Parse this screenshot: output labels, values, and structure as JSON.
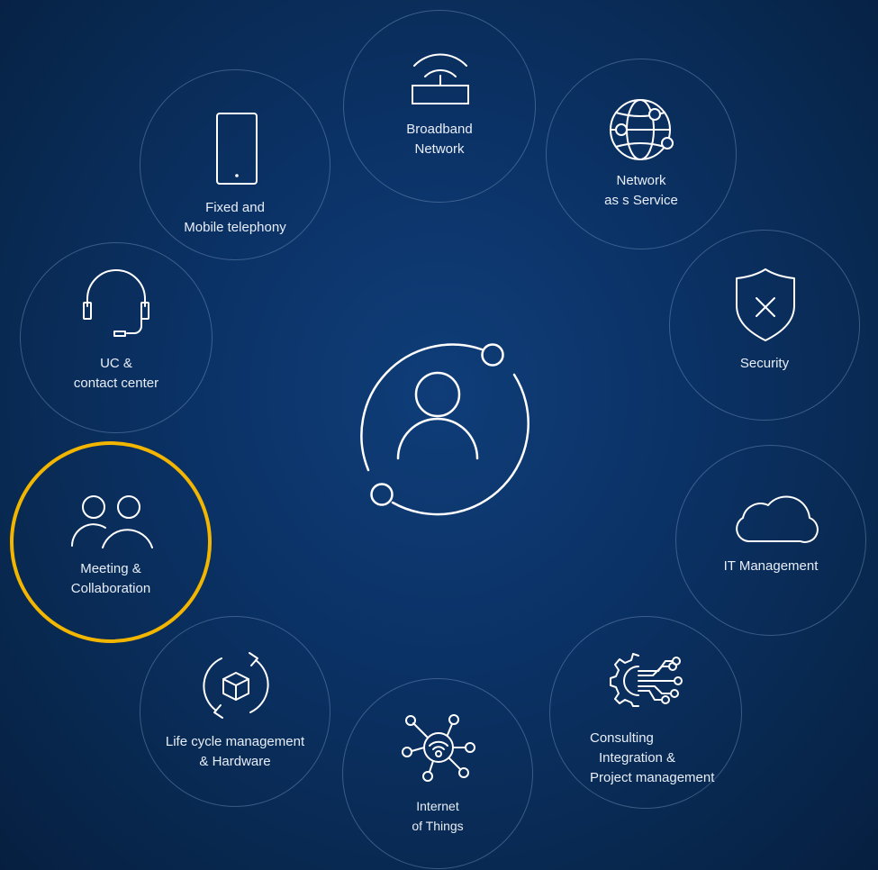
{
  "colors": {
    "background": "#0b3266",
    "ring": "#7896be",
    "highlight": "#f2b600",
    "icon": "#ffffff"
  },
  "center": {
    "icon": "user-icon"
  },
  "nodes": {
    "broadband": {
      "icon": "router-icon",
      "line1": "Broadband",
      "line2": "Network"
    },
    "naas": {
      "icon": "globe-network-icon",
      "line1": "Network",
      "line2": "as s Service"
    },
    "security": {
      "icon": "shield-icon",
      "line1": "Security"
    },
    "it_management": {
      "icon": "cloud-icon",
      "line1": "IT Management"
    },
    "consulting": {
      "icon": "gear-circuit-icon",
      "line1": "Consulting",
      "line2": "Integration &",
      "line3": "Project management"
    },
    "iot": {
      "icon": "iot-hub-icon",
      "line1": "Internet",
      "line2": "of Things"
    },
    "lifecycle": {
      "icon": "cycle-box-icon",
      "line1": "Life cycle management",
      "line2": "& Hardware"
    },
    "meeting": {
      "icon": "two-users-icon",
      "line1": "Meeting &",
      "line2": "Collaboration",
      "highlighted": true
    },
    "uc": {
      "icon": "headset-icon",
      "line1": "UC  &",
      "line2": "contact center"
    },
    "telephony": {
      "icon": "mobile-phone-icon",
      "line1": "Fixed and",
      "line2": "Mobile telephony"
    }
  }
}
